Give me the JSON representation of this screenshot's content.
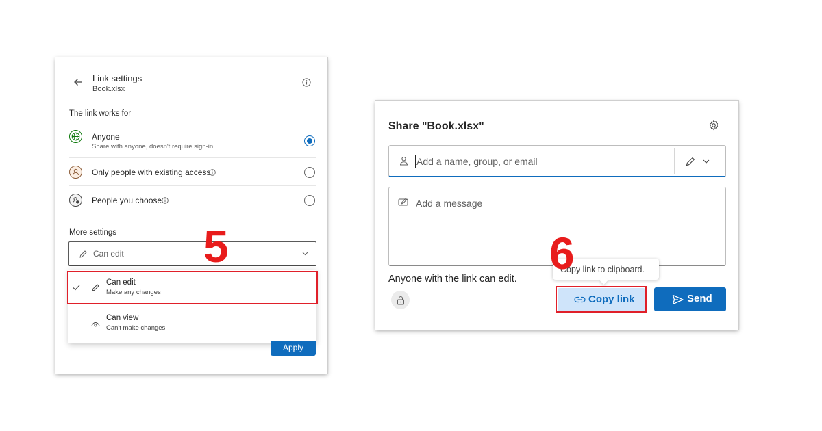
{
  "link_settings": {
    "title": "Link settings",
    "filename": "Book.xlsx",
    "section_link_works_for": "The link works for",
    "options": [
      {
        "label": "Anyone",
        "description": "Share with anyone, doesn't require sign-in",
        "selected": true
      },
      {
        "label": "Only people with existing access",
        "selected": false
      },
      {
        "label": "People you choose",
        "selected": false
      }
    ],
    "section_more_settings": "More settings",
    "permission_dropdown": {
      "value": "Can edit"
    },
    "permission_options": [
      {
        "label": "Can edit",
        "description": "Make any changes",
        "checked": true
      },
      {
        "label": "Can view",
        "description": "Can't make changes",
        "checked": false
      }
    ],
    "apply_label": "Apply",
    "step_number": "5"
  },
  "share_dialog": {
    "title": "Share \"Book.xlsx\"",
    "recipient_placeholder": "Add a name, group, or email",
    "message_placeholder": "Add a message",
    "link_status": "Anyone with the link can edit.",
    "tooltip": "Copy link to clipboard.",
    "copy_link_label": "Copy link",
    "send_label": "Send",
    "step_number": "6"
  },
  "colors": {
    "accent": "#0f6cbd",
    "highlight_red": "#e0202a",
    "step_number_red": "#e81c1c",
    "copy_link_bg": "#cfe4fa"
  }
}
